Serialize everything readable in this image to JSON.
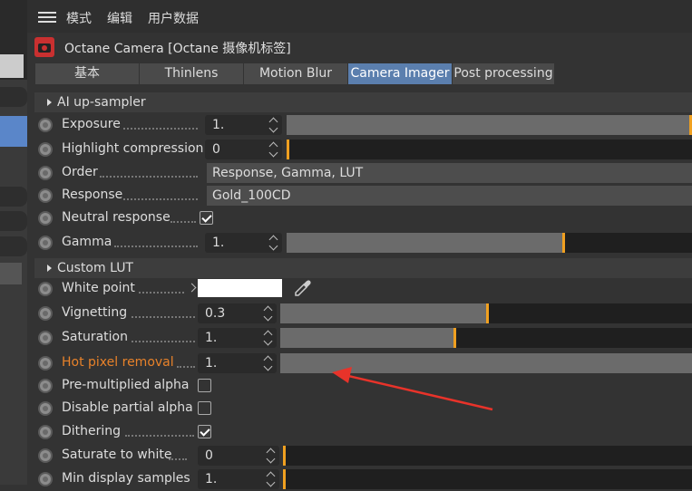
{
  "menu": {
    "items": [
      "模式",
      "编辑",
      "用户数据"
    ]
  },
  "title": "Octane Camera [Octane 摄像机标签]",
  "tabs": [
    {
      "label": "基本",
      "active": false
    },
    {
      "label": "Thinlens",
      "active": false
    },
    {
      "label": "Motion Blur",
      "active": false
    },
    {
      "label": "Camera Imager",
      "active": true
    },
    {
      "label": "Post processing",
      "active": false
    }
  ],
  "sections": {
    "ai_upsampler": "AI up-sampler",
    "custom_lut": "Custom LUT"
  },
  "params": {
    "exposure": {
      "label": "Exposure",
      "value": "1.",
      "level": 1.0
    },
    "highlight": {
      "label": "Highlight compression",
      "value": "0",
      "level": 0.0
    },
    "order": {
      "label": "Order",
      "value": "Response, Gamma, LUT"
    },
    "response": {
      "label": "Response",
      "value": "Gold_100CD"
    },
    "neutral": {
      "label": "Neutral response",
      "checked": true
    },
    "gamma": {
      "label": "Gamma",
      "value": "1.",
      "level": 0.68
    },
    "white_point": {
      "label": "White point",
      "color": "#ffffff"
    },
    "vignetting": {
      "label": "Vignetting",
      "value": "0.3",
      "level": 0.5
    },
    "saturation": {
      "label": "Saturation",
      "value": "1.",
      "level": 0.42
    },
    "hot_pixel": {
      "label": "Hot pixel removal",
      "value": "1.",
      "level": 1.0
    },
    "premult": {
      "label": "Pre-multiplied alpha",
      "checked": false
    },
    "disable_partial": {
      "label": "Disable partial alpha",
      "checked": false
    },
    "dithering": {
      "label": "Dithering",
      "checked": true
    },
    "saturate_white": {
      "label": "Saturate to white",
      "value": "0",
      "level": 0.0
    },
    "min_display": {
      "label": "Min display samples",
      "value": "1.",
      "level": 0.0
    }
  },
  "colors": {
    "accent": "#f0a020",
    "active_tab": "#5b7fae",
    "highlight_label": "#e8822a",
    "annotation": "#e8332a"
  }
}
